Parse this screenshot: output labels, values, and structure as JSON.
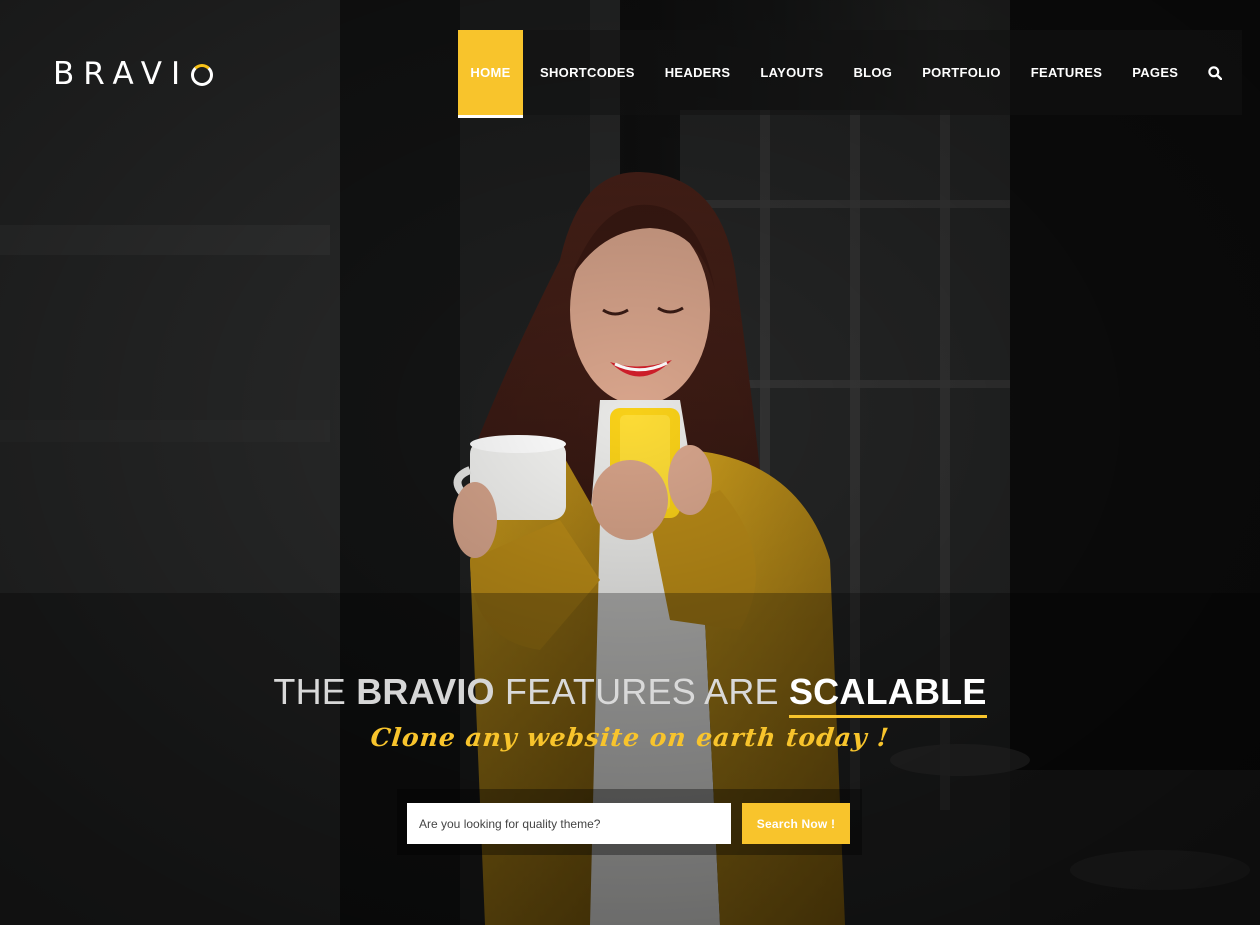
{
  "brand": {
    "name": "BRAVI",
    "accent": "#f8c42c"
  },
  "nav": {
    "items": [
      {
        "label": "HOME",
        "active": true
      },
      {
        "label": "SHORTCODES"
      },
      {
        "label": "HEADERS"
      },
      {
        "label": "LAYOUTS"
      },
      {
        "label": "BLOG"
      },
      {
        "label": "PORTFOLIO"
      },
      {
        "label": "FEATURES"
      },
      {
        "label": "PAGES"
      }
    ],
    "search_icon": "search-icon"
  },
  "hero": {
    "headline": {
      "part1": "THE ",
      "part2": "BRAVIO",
      "part3": " FEATURES ARE ",
      "part4": "SCALABLE"
    },
    "tagline": "Clone any website on earth today !",
    "search": {
      "placeholder": "Are you looking for quality theme?",
      "value": "",
      "button_label": "Search Now !"
    },
    "image_subject": "woman-with-coffee-and-yellow-phone"
  }
}
